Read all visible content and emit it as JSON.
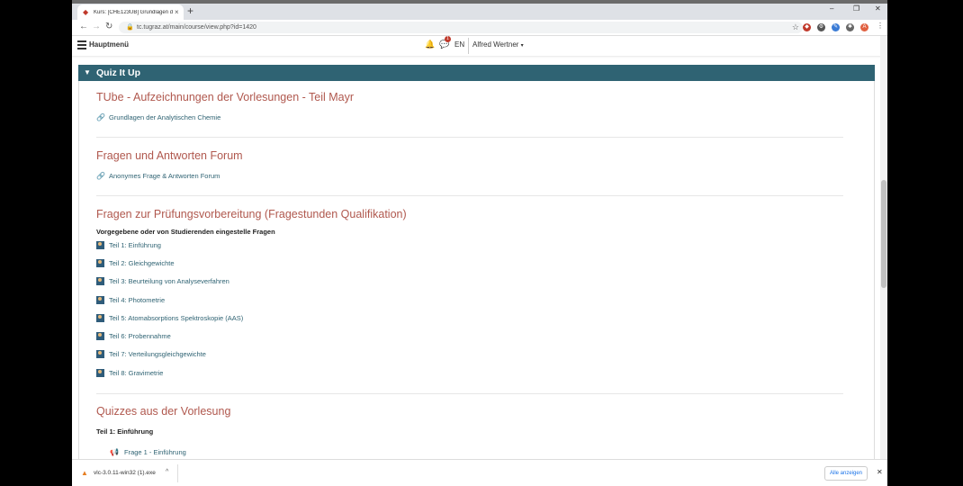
{
  "browser": {
    "tab_title": "Kurs: [CHE123UB] Grundlagen d…",
    "url": "tc.tugraz.at/main/course/view.php?id=1420",
    "new_tab": "+",
    "win_min": "–",
    "win_max": "❐",
    "win_close": "✕"
  },
  "nav": {
    "menu_label": "Hauptmenü",
    "message_count": "1",
    "language": "EN",
    "user_name": "Alfred Wertner"
  },
  "section": {
    "title": "Quiz It Up"
  },
  "blocks": [
    {
      "heading": "TUbe - Aufzeichnungen der Vorlesungen - Teil Mayr",
      "link": "Grundlagen der Analytischen Chemie"
    },
    {
      "heading": "Fragen und Antworten Forum",
      "link": "Anonymes Frage & Antworten Forum"
    }
  ],
  "exam_prep": {
    "heading": "Fragen zur Prüfungsvorbereitung (Fragestunden Qualifikation)",
    "subtitle": "Vorgegebene oder von Studierenden eingestelle Fragen",
    "items": [
      "Teil 1: Einführung",
      "Teil 2: Gleichgewichte",
      "Teil 3: Beurteilung von Analyseverfahren",
      "Teil 4: Photometrie",
      "Teil 5: Atomabsorptions Spektroskopie (AAS)",
      "Teil 6: Probennahme",
      "Teil 7: Verteilungsgleichgewichte",
      "Teil 8: Gravimetrie"
    ]
  },
  "lecture_quizzes": {
    "heading": "Quizzes aus der Vorlesung",
    "subtitle": "Teil 1: Einführung",
    "item": "Frage 1 - Einführung"
  },
  "download": {
    "file_name": "vlc-3.0.11-win32 (1).exe",
    "show_all": "Alle anzeigen"
  },
  "colors": {
    "accent": "#2f6373",
    "heading": "#b0584e",
    "link": "#2f6373"
  }
}
